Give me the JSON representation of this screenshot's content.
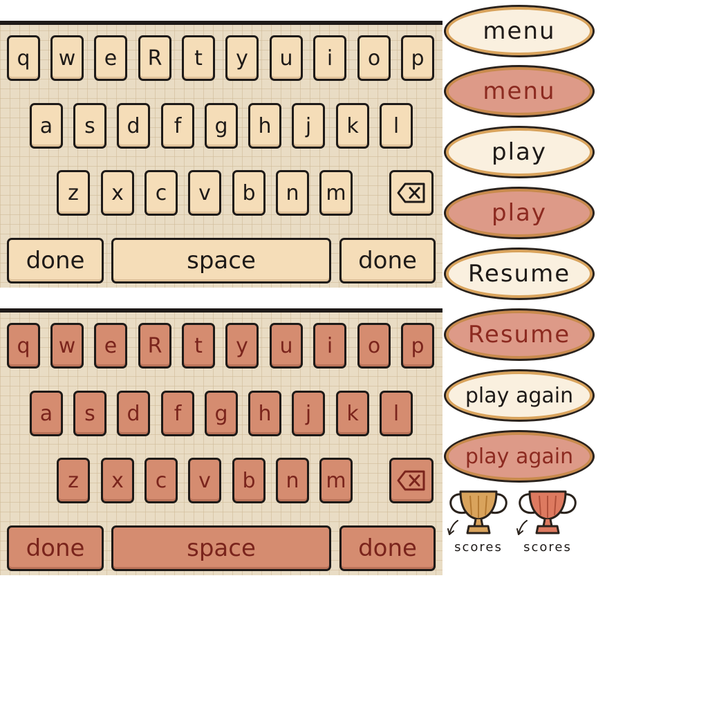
{
  "keyboard": {
    "row1": [
      "q",
      "w",
      "e",
      "R",
      "t",
      "y",
      "u",
      "i",
      "o",
      "p"
    ],
    "row2": [
      "a",
      "s",
      "d",
      "f",
      "g",
      "h",
      "j",
      "k",
      "l"
    ],
    "row3": [
      "z",
      "x",
      "c",
      "v",
      "b",
      "n",
      "m"
    ],
    "backspace_icon": "backspace-icon",
    "done_label": "done",
    "space_label": "space"
  },
  "buttons": {
    "menu": "menu",
    "play": "play",
    "resume": "Resume",
    "play_again": "play again"
  },
  "scores": {
    "label": "scores",
    "icon": "trophy-icon"
  },
  "colors": {
    "panel": "#e9dcc4",
    "key_light": "#f5ddb8",
    "key_pressed": "#d58c70",
    "text_dark": "#1e1a18",
    "text_pressed": "#7a241c",
    "button_light": "#faf0df",
    "button_pressed": "#dd9a88",
    "trophy_gold": "#d9a35c",
    "trophy_red": "#dd7a60"
  }
}
